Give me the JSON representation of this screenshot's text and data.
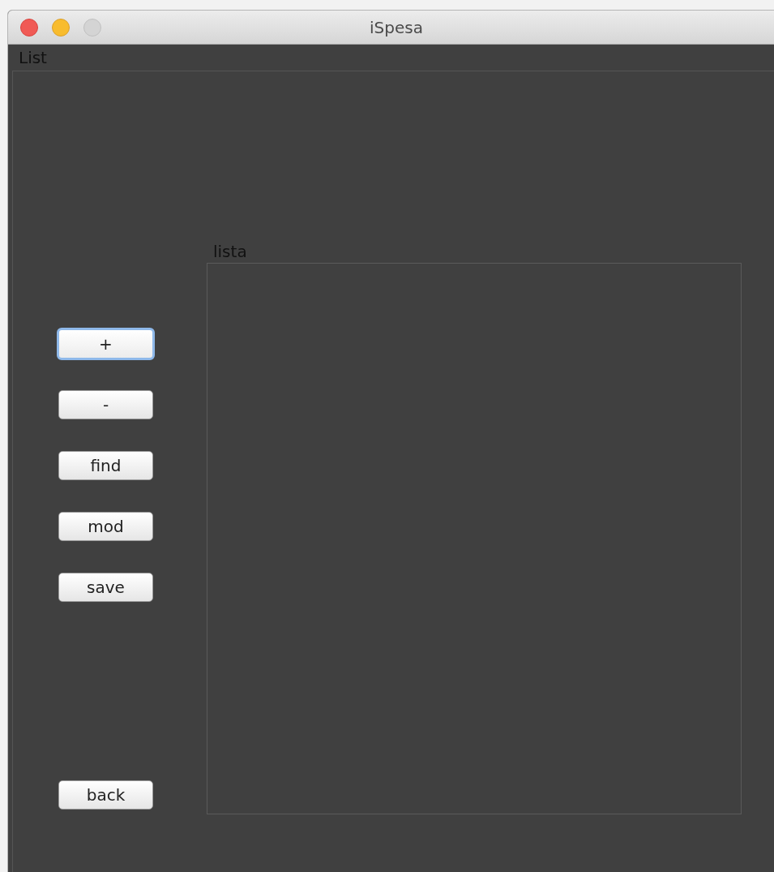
{
  "window": {
    "title": "iSpesa"
  },
  "menu_label": "List",
  "buttons": [
    {
      "label": "+",
      "focused": true
    },
    {
      "label": "-",
      "focused": false
    },
    {
      "label": "find",
      "focused": false
    },
    {
      "label": "mod",
      "focused": false
    },
    {
      "label": "save",
      "focused": false
    }
  ],
  "back_button": {
    "label": "back",
    "focused": false
  },
  "list": {
    "label": "lista"
  }
}
